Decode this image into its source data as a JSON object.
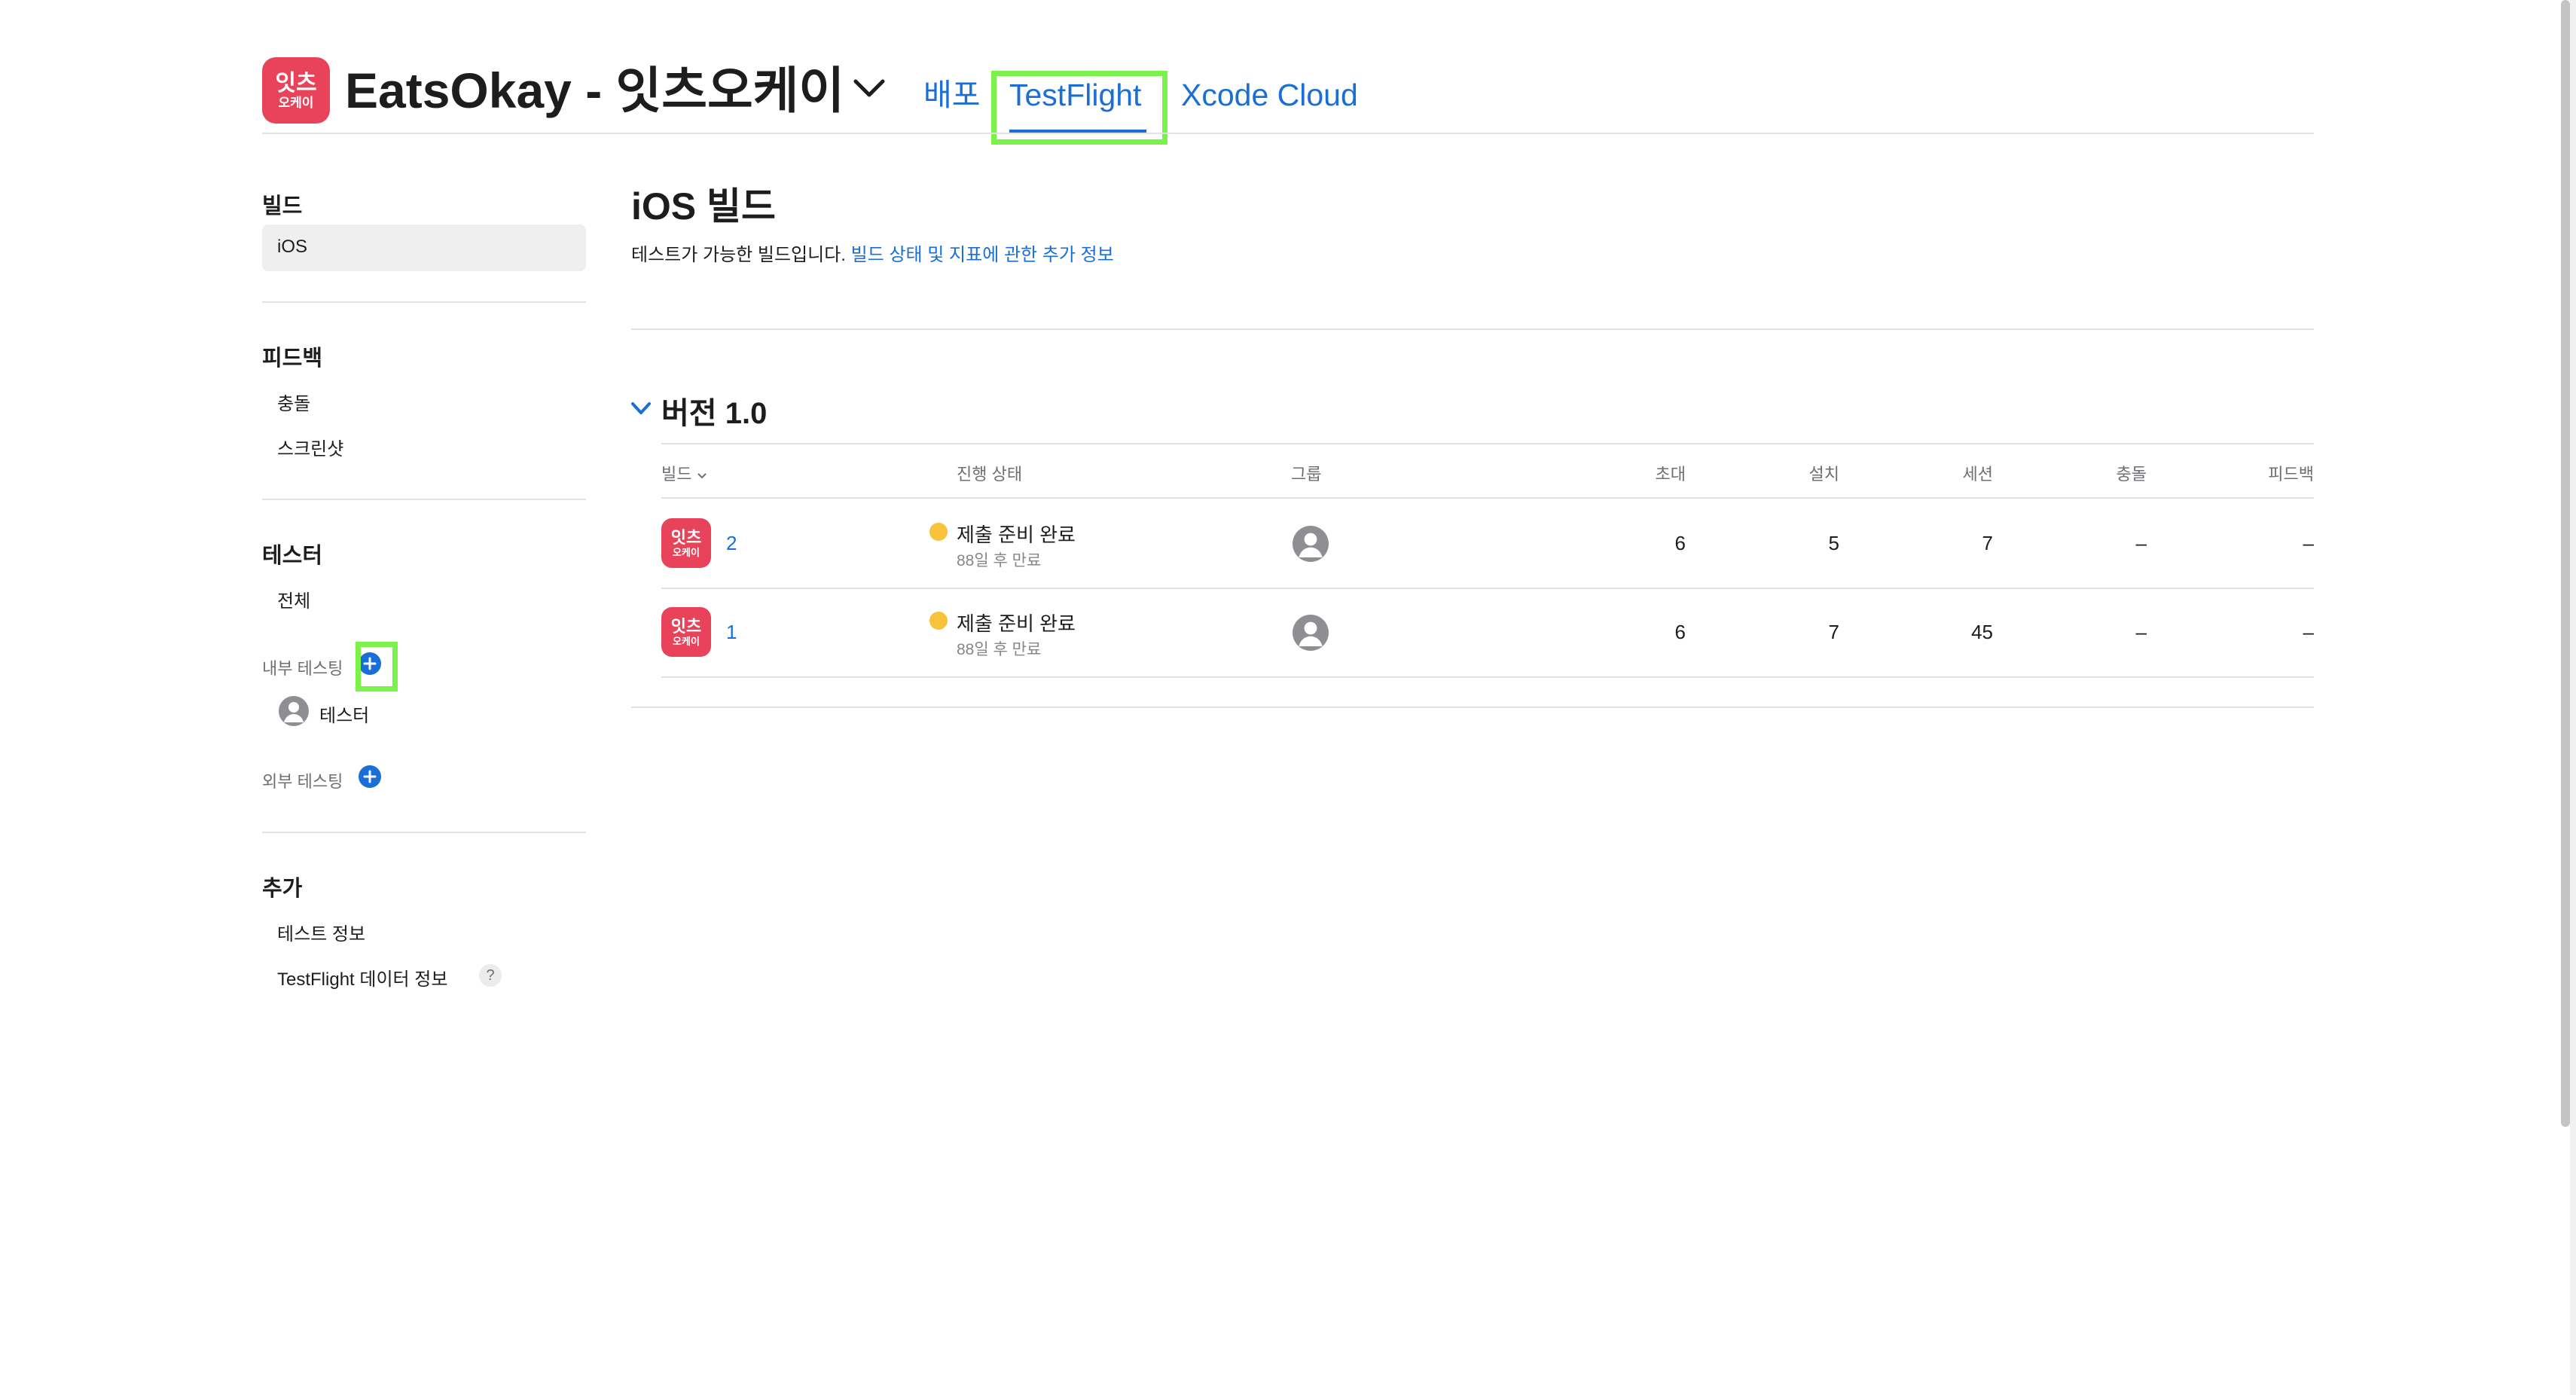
{
  "app": {
    "icon_line1": "잇츠",
    "icon_line2": "오케이",
    "title": "EatsOkay - 잇츠오케이"
  },
  "nav": {
    "tabs": [
      {
        "label": "배포",
        "active": false
      },
      {
        "label": "TestFlight",
        "active": true
      },
      {
        "label": "Xcode Cloud",
        "active": false
      }
    ]
  },
  "sidebar": {
    "builds_header": "빌드",
    "builds_ios": "iOS",
    "feedback_header": "피드백",
    "feedback_crashes": "충돌",
    "feedback_screenshots": "스크린샷",
    "testers_header": "테스터",
    "testers_all": "전체",
    "internal_testing": "내부 테스팅",
    "internal_group": "테스터",
    "external_testing": "외부 테스팅",
    "more_header": "추가",
    "more_test_info": "테스트 정보",
    "more_data_info": "TestFlight 데이터 정보",
    "help_glyph": "?"
  },
  "main": {
    "title": "iOS 빌드",
    "description": "테스트가 가능한 빌드입니다.",
    "description_link": "빌드 상태 및 지표에 관한 추가 정보",
    "version_title": "버전 1.0"
  },
  "table": {
    "headers": {
      "build": "빌드",
      "status": "진행 상태",
      "group": "그룹",
      "invites": "초대",
      "installs": "설치",
      "sessions": "세션",
      "crashes": "충돌",
      "feedback": "피드백"
    },
    "rows": [
      {
        "build": "2",
        "status": "제출 준비 완료",
        "expiry": "88일 후 만료",
        "invites": "6",
        "installs": "5",
        "sessions": "7",
        "crashes": "–",
        "feedback": "–"
      },
      {
        "build": "1",
        "status": "제출 준비 완료",
        "expiry": "88일 후 만료",
        "invites": "6",
        "installs": "7",
        "sessions": "45",
        "crashes": "–",
        "feedback": "–"
      }
    ]
  },
  "colors": {
    "accent": "#1a6fd6",
    "app_icon": "#e8435a",
    "highlight": "#79f24a",
    "status_pending": "#f6c33a"
  }
}
